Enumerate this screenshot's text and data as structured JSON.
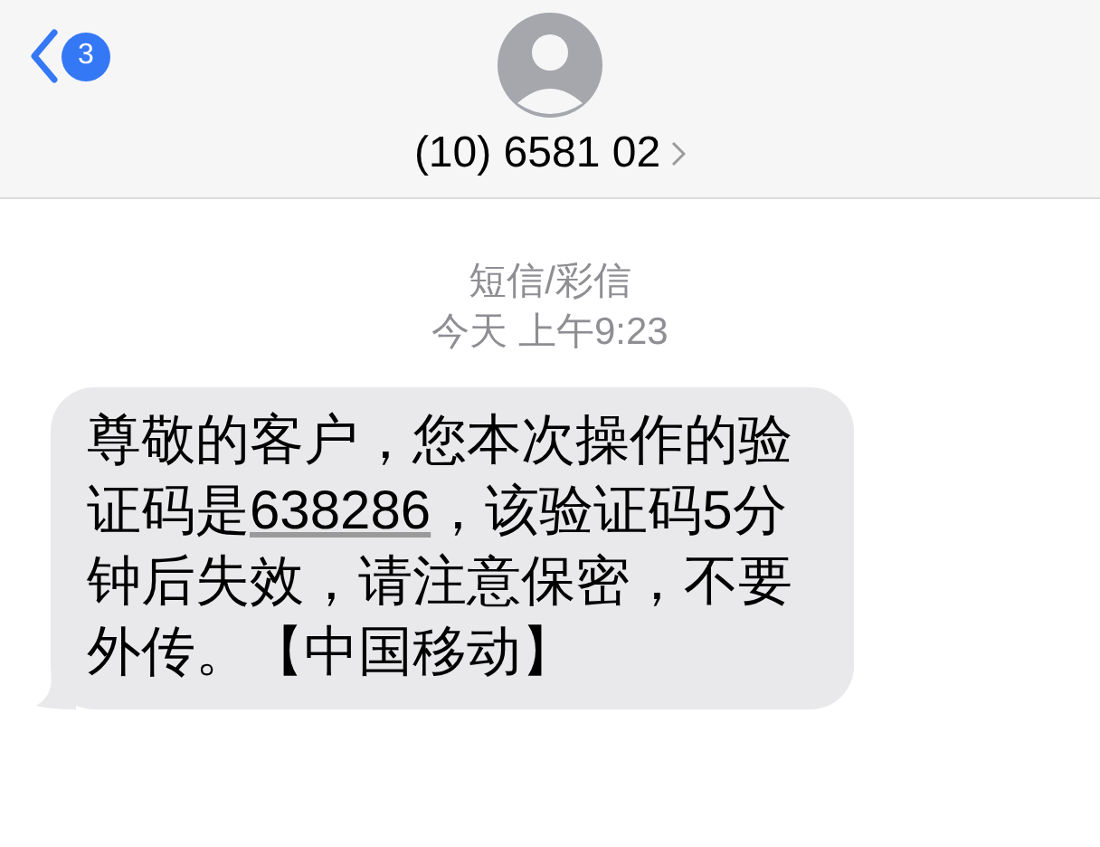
{
  "header": {
    "back_badge": "3",
    "contact": "(10) 6581 02"
  },
  "thread": {
    "service": "短信/彩信",
    "time": "今天 上午9:23"
  },
  "message": {
    "before": "尊敬的客户，您本次操作的验证码是",
    "code": "638286",
    "after": "，该验证码5分钟后失效，请注意保密，不要外传。【中国移动】"
  }
}
